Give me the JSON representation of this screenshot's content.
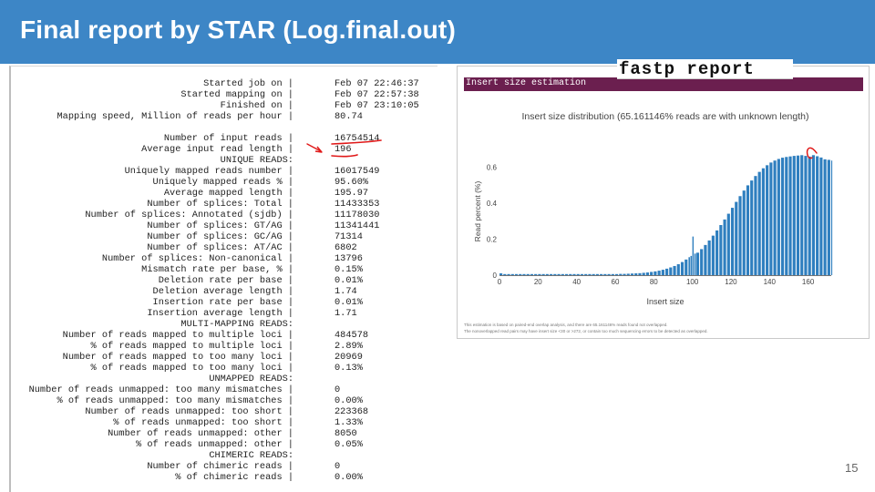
{
  "slide": {
    "title": "Final report by STAR (Log.final.out)",
    "page_number": "15"
  },
  "star_log": [
    {
      "kind": "row",
      "label": "Started job on |",
      "value": "Feb 07 22:46:37"
    },
    {
      "kind": "row",
      "label": "Started mapping on |",
      "value": "Feb 07 22:57:38"
    },
    {
      "kind": "row",
      "label": "Finished on |",
      "value": "Feb 07 23:10:05"
    },
    {
      "kind": "row",
      "label": "Mapping speed, Million of reads per hour |",
      "value": "80.74"
    },
    {
      "kind": "blank"
    },
    {
      "kind": "row",
      "label": "Number of input reads |",
      "value": "16754514"
    },
    {
      "kind": "row",
      "label": "Average input read length |",
      "value": "196"
    },
    {
      "kind": "section",
      "label": "UNIQUE READS:"
    },
    {
      "kind": "row",
      "label": "Uniquely mapped reads number |",
      "value": "16017549"
    },
    {
      "kind": "row",
      "label": "Uniquely mapped reads % |",
      "value": "95.60%"
    },
    {
      "kind": "row",
      "label": "Average mapped length |",
      "value": "195.97"
    },
    {
      "kind": "row",
      "label": "Number of splices: Total |",
      "value": "11433353"
    },
    {
      "kind": "row",
      "label": "Number of splices: Annotated (sjdb) |",
      "value": "11178030"
    },
    {
      "kind": "row",
      "label": "Number of splices: GT/AG |",
      "value": "11341441"
    },
    {
      "kind": "row",
      "label": "Number of splices: GC/AG |",
      "value": "71314"
    },
    {
      "kind": "row",
      "label": "Number of splices: AT/AC |",
      "value": "6802"
    },
    {
      "kind": "row",
      "label": "Number of splices: Non-canonical |",
      "value": "13796"
    },
    {
      "kind": "row",
      "label": "Mismatch rate per base, % |",
      "value": "0.15%"
    },
    {
      "kind": "row",
      "label": "Deletion rate per base |",
      "value": "0.01%"
    },
    {
      "kind": "row",
      "label": "Deletion average length |",
      "value": "1.74"
    },
    {
      "kind": "row",
      "label": "Insertion rate per base |",
      "value": "0.01%"
    },
    {
      "kind": "row",
      "label": "Insertion average length |",
      "value": "1.71"
    },
    {
      "kind": "section",
      "label": "MULTI-MAPPING READS:"
    },
    {
      "kind": "row",
      "label": "Number of reads mapped to multiple loci |",
      "value": "484578"
    },
    {
      "kind": "row",
      "label": "% of reads mapped to multiple loci |",
      "value": "2.89%"
    },
    {
      "kind": "row",
      "label": "Number of reads mapped to too many loci |",
      "value": "20969"
    },
    {
      "kind": "row",
      "label": "% of reads mapped to too many loci |",
      "value": "0.13%"
    },
    {
      "kind": "section",
      "label": "UNMAPPED READS:"
    },
    {
      "kind": "row",
      "label": "Number of reads unmapped: too many mismatches |",
      "value": "0"
    },
    {
      "kind": "row",
      "label": "% of reads unmapped: too many mismatches |",
      "value": "0.00%"
    },
    {
      "kind": "row",
      "label": "Number of reads unmapped: too short |",
      "value": "223368"
    },
    {
      "kind": "row",
      "label": "% of reads unmapped: too short |",
      "value": "1.33%"
    },
    {
      "kind": "row",
      "label": "Number of reads unmapped: other |",
      "value": "8050"
    },
    {
      "kind": "row",
      "label": "% of reads unmapped: other |",
      "value": "0.05%"
    },
    {
      "kind": "section",
      "label": "CHIMERIC READS:"
    },
    {
      "kind": "row",
      "label": "Number of chimeric reads |",
      "value": "0"
    },
    {
      "kind": "row",
      "label": "% of chimeric reads |",
      "value": "0.00%"
    }
  ],
  "fastp": {
    "badge": "fastp report",
    "section_header": "Insert size estimation",
    "footnote_line1": "This estimation is based on paired-end overlap analysis, and there are 65.161146% reads found not overlapped.",
    "footnote_line2": "The nonoverlapped read pairs may have insert size <30 or >272, or contain too much sequencing errors to be detected as overlapped."
  },
  "annotation_color": "#e01818",
  "chart_data": {
    "type": "bar",
    "title": "Insert size distribution (65.161146% reads are with unknown length)",
    "xlabel": "Insert size",
    "ylabel": "Read percent (%)",
    "xlim": [
      0,
      172
    ],
    "ylim": [
      0,
      0.7
    ],
    "xticks": [
      0,
      20,
      40,
      60,
      80,
      100,
      120,
      140,
      160
    ],
    "yticks": [
      0,
      0.2,
      0.4,
      0.6
    ],
    "bar_color": "#2f7fbf",
    "grid": false,
    "legend": "none",
    "x": [
      0,
      2,
      4,
      6,
      8,
      10,
      12,
      14,
      16,
      18,
      20,
      22,
      24,
      26,
      28,
      30,
      32,
      34,
      36,
      38,
      40,
      42,
      44,
      46,
      48,
      50,
      52,
      54,
      56,
      58,
      60,
      62,
      64,
      66,
      68,
      70,
      72,
      74,
      76,
      78,
      80,
      82,
      84,
      86,
      88,
      90,
      92,
      94,
      96,
      98,
      99,
      100,
      101,
      102,
      104,
      106,
      108,
      110,
      112,
      114,
      116,
      118,
      120,
      122,
      124,
      126,
      128,
      130,
      132,
      134,
      136,
      138,
      140,
      142,
      144,
      146,
      148,
      150,
      152,
      154,
      156,
      158,
      160,
      162,
      164,
      166,
      168,
      170,
      172
    ],
    "values": [
      0.01,
      0.006,
      0.006,
      0.006,
      0.006,
      0.006,
      0.006,
      0.006,
      0.006,
      0.006,
      0.006,
      0.006,
      0.006,
      0.006,
      0.006,
      0.006,
      0.006,
      0.006,
      0.006,
      0.006,
      0.006,
      0.006,
      0.006,
      0.006,
      0.006,
      0.006,
      0.006,
      0.006,
      0.006,
      0.006,
      0.006,
      0.007,
      0.007,
      0.008,
      0.009,
      0.01,
      0.011,
      0.013,
      0.015,
      0.018,
      0.021,
      0.025,
      0.03,
      0.036,
      0.043,
      0.051,
      0.061,
      0.073,
      0.087,
      0.1,
      0.107,
      0.215,
      0.12,
      0.125,
      0.145,
      0.168,
      0.193,
      0.22,
      0.249,
      0.279,
      0.31,
      0.342,
      0.375,
      0.408,
      0.44,
      0.471,
      0.5,
      0.527,
      0.552,
      0.575,
      0.595,
      0.612,
      0.627,
      0.638,
      0.647,
      0.654,
      0.658,
      0.661,
      0.664,
      0.666,
      0.668,
      0.664,
      0.66,
      0.668,
      0.662,
      0.655,
      0.645,
      0.642,
      0.638
    ]
  }
}
